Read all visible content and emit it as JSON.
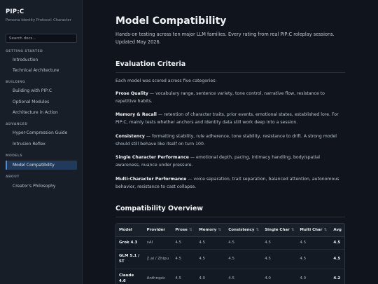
{
  "sidebar": {
    "brand": "PIP:C",
    "tagline": "Persona Identity Protocol: Character",
    "search_placeholder": "Search docs...",
    "sections": [
      {
        "title": "GETTING STARTED",
        "items": [
          {
            "label": "Introduction"
          },
          {
            "label": "Technical Architecture"
          }
        ]
      },
      {
        "title": "BUILDING",
        "items": [
          {
            "label": "Building with PIP:C"
          },
          {
            "label": "Optional Modules"
          },
          {
            "label": "Architecture in Action"
          }
        ]
      },
      {
        "title": "ADVANCED",
        "items": [
          {
            "label": "Hyper-Compression Guide"
          },
          {
            "label": "Intrusion Reflex"
          }
        ]
      },
      {
        "title": "MODELS",
        "items": [
          {
            "label": "Model Compatibility",
            "active": true
          }
        ]
      },
      {
        "title": "ABOUT",
        "items": [
          {
            "label": "Creator's Philosophy"
          }
        ]
      }
    ]
  },
  "main": {
    "title": "Model Compatibility",
    "intro": "Hands-on testing across ten major LLM families. Every rating from real PIP:C roleplay sessions. Updated May 2026.",
    "criteria": {
      "heading": "Evaluation Criteria",
      "lead": "Each model was scored across five categories:",
      "items": [
        {
          "term": "Prose Quality",
          "desc": " — vocabulary range, sentence variety, tone control, narrative flow, resistance to repetitive habits."
        },
        {
          "term": "Memory & Recall",
          "desc": " — retention of character traits, prior events, emotional states, established lore. For PIP:C, mainly tests whether anchors and identity data still work deep into a session."
        },
        {
          "term": "Consistency",
          "desc": " — formatting stability, rule adherence, tone stability, resistance to drift. A strong model should still behave like itself on turn 100."
        },
        {
          "term": "Single Character Performance",
          "desc": " — emotional depth, pacing, intimacy handling, body/spatial awareness, nuance under pressure."
        },
        {
          "term": "Multi-Character Performance",
          "desc": " — voice separation, trait separation, balanced attention, autonomous behavior, resistance to cast collapse."
        }
      ]
    },
    "overview": {
      "heading": "Compatibility Overview",
      "sort_glyph": "⇅",
      "columns": [
        "Model",
        "Provider",
        "Prose",
        "Memory",
        "Consistency",
        "Single Char",
        "Multi Char",
        "Avg"
      ],
      "rows": [
        [
          "Grok 4.3",
          "xAI",
          "4.5",
          "4.5",
          "4.5",
          "4.5",
          "4.5",
          "4.5"
        ],
        [
          "GLM 5.1 / 5T",
          "Z.ai / Zhipu",
          "4.5",
          "4.5",
          "4.5",
          "4.5",
          "4.5",
          "4.5"
        ],
        [
          "Claude 4.6",
          "Anthropic",
          "4.5",
          "4.0",
          "4.5",
          "4.0",
          "4.0",
          "4.2"
        ]
      ]
    }
  }
}
